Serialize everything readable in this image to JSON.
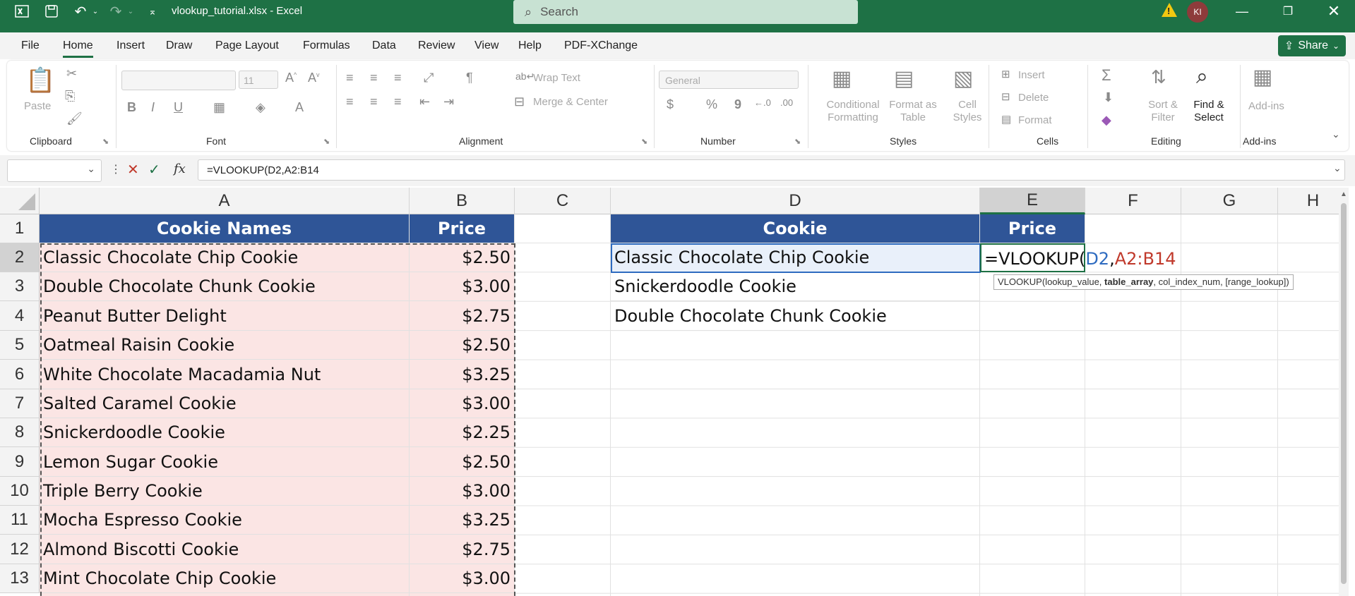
{
  "titlebar": {
    "filename": "vlookup_tutorial.xlsx",
    "separator": " - ",
    "app": "Excel",
    "search_placeholder": "Search",
    "avatar_initials": "KI"
  },
  "menu": [
    "File",
    "Home",
    "Insert",
    "Draw",
    "Page Layout",
    "Formulas",
    "Data",
    "Review",
    "View",
    "Help",
    "PDF-XChange"
  ],
  "share_label": "Share",
  "ribbon": {
    "clipboard": {
      "paste": "Paste",
      "label": "Clipboard"
    },
    "font": {
      "font_size": "11",
      "label": "Font",
      "bold": "B",
      "italic": "I",
      "underline": "U"
    },
    "alignment": {
      "wrap_text": "Wrap Text",
      "merge_center": "Merge & Center",
      "label": "Alignment"
    },
    "number": {
      "format": "General",
      "currency": "$",
      "percent": "%",
      "comma": "9",
      "label": "Number"
    },
    "styles": {
      "conditional": [
        "Conditional",
        "Formatting"
      ],
      "format_table": [
        "Format as",
        "Table"
      ],
      "cell_styles": [
        "Cell",
        "Styles"
      ],
      "label": "Styles"
    },
    "cells": {
      "insert": "Insert",
      "delete": "Delete",
      "format": "Format",
      "label": "Cells"
    },
    "editing": {
      "sort_filter": [
        "Sort &",
        "Filter"
      ],
      "find_select": [
        "Find &",
        "Select"
      ],
      "label": "Editing"
    },
    "addins": {
      "addins": "Add-ins",
      "label": "Add-ins"
    }
  },
  "formula_bar": {
    "fx": "fx",
    "formula": "=VLOOKUP(D2,A2:B14"
  },
  "columns": [
    "A",
    "B",
    "C",
    "D",
    "E",
    "F",
    "G",
    "H"
  ],
  "rows": [
    "1",
    "2",
    "3",
    "4",
    "5",
    "6",
    "7",
    "8",
    "9",
    "10",
    "11",
    "12",
    "13"
  ],
  "table_left": {
    "headers": [
      "Cookie Names",
      "Price"
    ],
    "rows": [
      [
        "Classic Chocolate Chip Cookie",
        "$2.50"
      ],
      [
        "Double Chocolate Chunk Cookie",
        "$3.00"
      ],
      [
        "Peanut Butter Delight",
        "$2.75"
      ],
      [
        "Oatmeal Raisin Cookie",
        "$2.50"
      ],
      [
        "White Chocolate Macadamia Nut",
        "$3.25"
      ],
      [
        "Salted Caramel Cookie",
        "$3.00"
      ],
      [
        "Snickerdoodle Cookie",
        "$2.25"
      ],
      [
        "Lemon Sugar Cookie",
        "$2.50"
      ],
      [
        "Triple Berry Cookie",
        "$3.00"
      ],
      [
        "Mocha Espresso Cookie",
        "$3.25"
      ],
      [
        "Almond Biscotti Cookie",
        "$2.75"
      ],
      [
        "Mint Chocolate Chip Cookie",
        "$3.00"
      ]
    ]
  },
  "table_right": {
    "headers": [
      "Cookie",
      "Price"
    ],
    "rows": [
      [
        "Classic Chocolate Chip Cookie"
      ],
      [
        "Snickerdoodle Cookie"
      ],
      [
        "Double Chocolate Chunk Cookie"
      ]
    ]
  },
  "editing_cell": {
    "fn": "=VLOOKUP(",
    "ref1": "D2",
    "comma": ",",
    "ref2": "A2:B14"
  },
  "tooltip": {
    "fn": "VLOOKUP(lookup_value, ",
    "bold_arg": "table_array",
    "rest": ", col_index_num, [range_lookup])"
  },
  "colors": {
    "header_fill": "#2f5597",
    "pink_fill": "#fbe5e4",
    "ref1": "#2e6bc0",
    "ref2": "#c0392b",
    "excel_green": "#1e7145"
  }
}
